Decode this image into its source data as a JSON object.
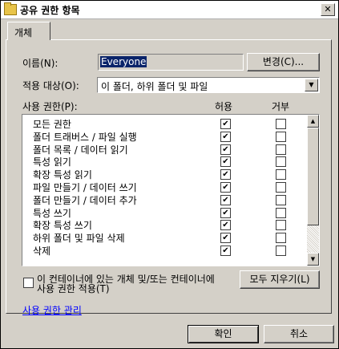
{
  "window": {
    "title": "공유 권한 항목",
    "close_glyph": "✕"
  },
  "tabs": [
    "개체"
  ],
  "name": {
    "label": "이름(N):",
    "value": "Everyone",
    "change_button": "변경(C)..."
  },
  "apply_to": {
    "label": "적용 대상(O):",
    "value": "이 폴더, 하위 폴더 및 파일"
  },
  "permissions": {
    "label": "사용 권한(P):",
    "allow_header": "허용",
    "deny_header": "거부",
    "rows": [
      {
        "name": "모든 권한",
        "allow": true,
        "deny": false
      },
      {
        "name": "폴더 트래버스 / 파일 실행",
        "allow": true,
        "deny": false
      },
      {
        "name": "폴더 목록 / 데이터 읽기",
        "allow": true,
        "deny": false
      },
      {
        "name": "특성 읽기",
        "allow": true,
        "deny": false
      },
      {
        "name": "확장 특성 읽기",
        "allow": true,
        "deny": false
      },
      {
        "name": "파일 만들기 / 데이터 쓰기",
        "allow": true,
        "deny": false
      },
      {
        "name": "폴더 만들기 / 데이터 추가",
        "allow": true,
        "deny": false
      },
      {
        "name": "특성 쓰기",
        "allow": true,
        "deny": false
      },
      {
        "name": "확장 특성 쓰기",
        "allow": true,
        "deny": false
      },
      {
        "name": "하위 폴더 및 파일 삭제",
        "allow": true,
        "deny": false
      },
      {
        "name": "삭제",
        "allow": true,
        "deny": false
      }
    ]
  },
  "apply_within": {
    "line1": "이 컨테이너에 있는 개체 및/또는 컨테이너에",
    "line2": "사용 권한 적용(T)",
    "checked": false
  },
  "clear_all_button": "모두 지우기(L)",
  "manage_link": "사용 권한 관리",
  "ok_button": "확인",
  "cancel_button": "취소"
}
